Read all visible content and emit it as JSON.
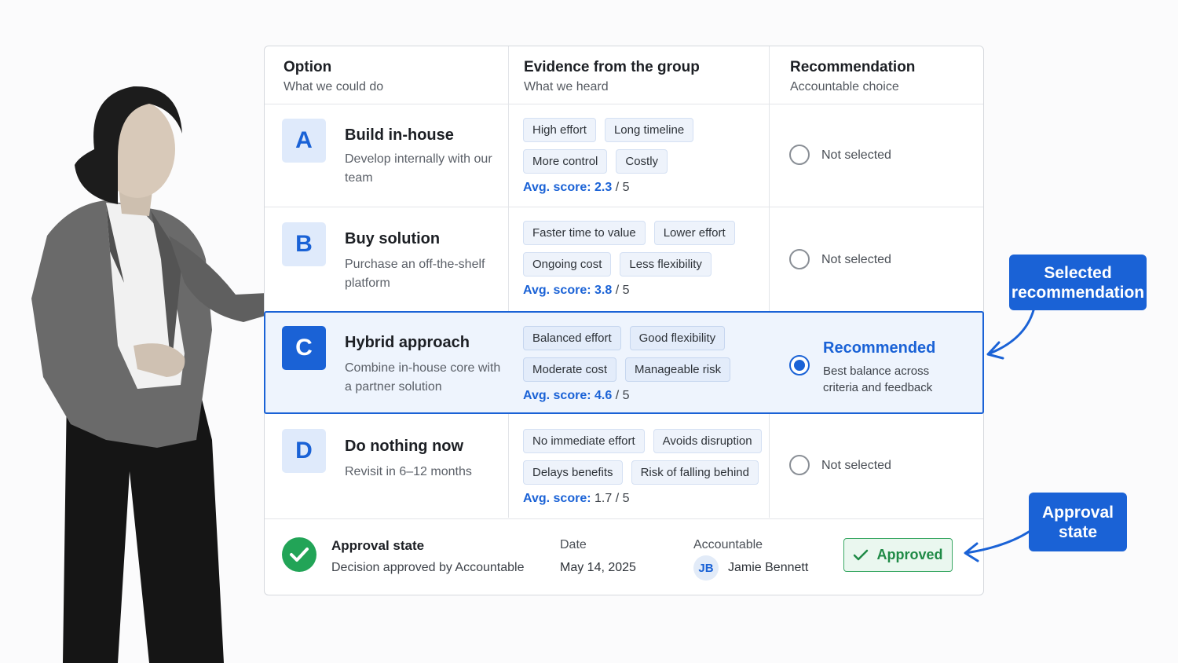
{
  "header": {
    "option": {
      "title": "Option",
      "subtitle": "What we could do"
    },
    "evidence": {
      "title": "Evidence from the group",
      "subtitle": "What we heard"
    },
    "recommendation": {
      "title": "Recommendation",
      "subtitle": "Accountable choice"
    }
  },
  "options": [
    {
      "letter": "A",
      "title": "Build in-house",
      "desc": "Develop internally with our team",
      "tags": [
        "High effort",
        "Long timeline",
        "More control",
        "Costly"
      ],
      "score_label": "Avg. score:",
      "score": "2.3",
      "score_max": " / 5",
      "status": "Not selected"
    },
    {
      "letter": "B",
      "title": "Buy solution",
      "desc": "Purchase an off-the-shelf platform",
      "tags": [
        "Faster time to value",
        "Lower effort",
        "Ongoing cost",
        "Less flexibility"
      ],
      "score_label": "Avg. score:",
      "score": "3.8",
      "score_max": " / 5",
      "status": "Not selected"
    },
    {
      "letter": "C",
      "title": "Hybrid approach",
      "desc": "Combine in-house core with a partner solution",
      "tags": [
        "Balanced effort",
        "Good flexibility",
        "Moderate cost",
        "Manageable risk"
      ],
      "score_label": "Avg. score:",
      "score": "4.6",
      "score_max": " / 5",
      "status": "Recommended",
      "status_desc": "Best balance across criteria and feedback"
    },
    {
      "letter": "D",
      "title": "Do nothing now",
      "desc": "Revisit in 6–12 months",
      "tags": [
        "No immediate effort",
        "Avoids disruption",
        "Delays benefits",
        "Risk of falling behind"
      ],
      "score_label": "Avg. score:",
      "score": "1.7",
      "score_max": " / 5",
      "status": "Not selected"
    }
  ],
  "approval": {
    "title": "Approval state",
    "desc": "Decision approved by Accountable",
    "date_label": "Date",
    "date": "May 14, 2025",
    "accountable_label": "Accountable",
    "initials": "JB",
    "name": "Jamie Bennett",
    "status": "Approved"
  },
  "callouts": {
    "selected": "Selected recommendation",
    "approval": "Approval state"
  },
  "colors": {
    "accent": "#1a62d6",
    "approved": "#22a457"
  },
  "icons": {
    "radio": "radio-icon",
    "check": "check-icon",
    "arrow": "arrow-icon"
  }
}
